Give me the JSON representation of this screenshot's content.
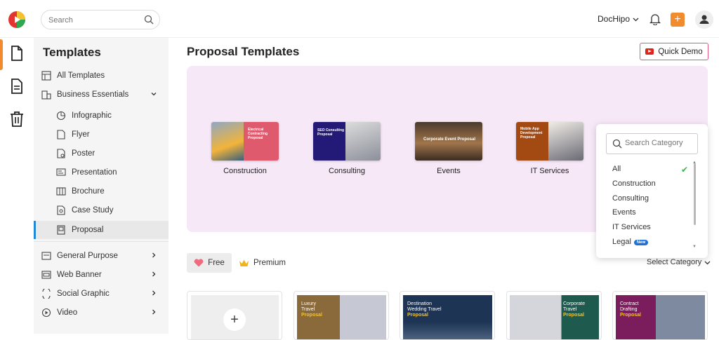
{
  "header": {
    "search_placeholder": "Search",
    "brand": "DocHipo"
  },
  "sidebar": {
    "title": "Templates",
    "items": [
      {
        "label": "All Templates"
      },
      {
        "label": "Business Essentials"
      },
      {
        "label": "Infographic"
      },
      {
        "label": "Flyer"
      },
      {
        "label": "Poster"
      },
      {
        "label": "Presentation"
      },
      {
        "label": "Brochure"
      },
      {
        "label": "Case Study"
      },
      {
        "label": "Proposal"
      },
      {
        "label": "General Purpose"
      },
      {
        "label": "Web Banner"
      },
      {
        "label": "Social Graphic"
      },
      {
        "label": "Video"
      }
    ]
  },
  "main": {
    "title": "Proposal Templates",
    "quick_demo": "Quick Demo",
    "categories": [
      {
        "label": "Construction",
        "thumb_text": "Electrical Contracting Proposal"
      },
      {
        "label": "Consulting",
        "thumb_text": "SEO Consulting Proposal"
      },
      {
        "label": "Events",
        "thumb_text": "Corporate Event Proposal"
      },
      {
        "label": "IT Services",
        "thumb_text": "Mobile App Development Proposal"
      }
    ],
    "filters": {
      "free": "Free",
      "premium": "Premium",
      "select_category": "Select Category"
    },
    "templates": [
      {
        "line1": "Luxury",
        "line2": "Travel",
        "line3": "Proposal"
      },
      {
        "line1": "Destination",
        "line2": "Wedding Travel",
        "line3": "Proposal"
      },
      {
        "line1": "Corporate",
        "line2": "Travel",
        "line3": "Proposal"
      },
      {
        "line1": "Contract",
        "line2": "Drafting",
        "line3": "Proposal"
      }
    ]
  },
  "dropdown": {
    "search_placeholder": "Search Category",
    "items": [
      "All",
      "Construction",
      "Consulting",
      "Events",
      "IT Services",
      "Legal"
    ],
    "new_badge": "New"
  },
  "colors": {
    "accent": "#f28a2e",
    "hero_bg": "#f7e8f8",
    "active_indicator": "#1f8ad8"
  }
}
